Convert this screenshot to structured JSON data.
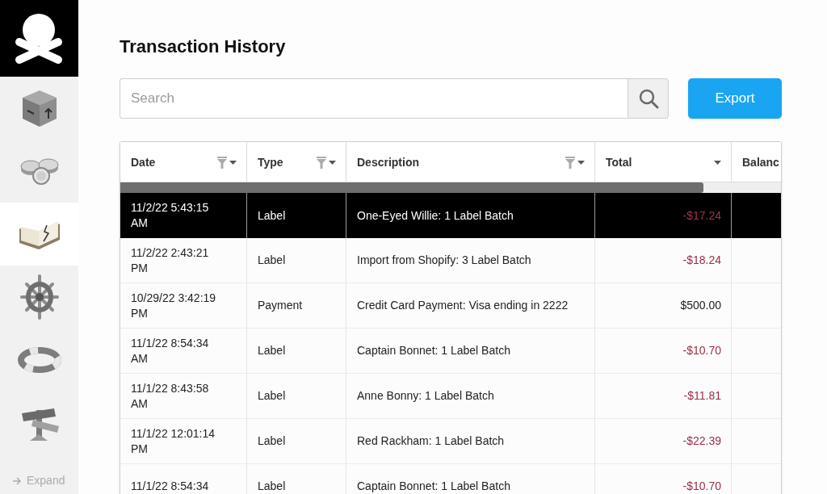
{
  "sidebar": {
    "nav_items": [
      {
        "selected": false
      },
      {
        "selected": false
      },
      {
        "selected": true
      },
      {
        "selected": false
      },
      {
        "selected": false
      },
      {
        "selected": false
      }
    ],
    "expand_label": "Expand"
  },
  "title": "Transaction History",
  "search": {
    "placeholder": "Search"
  },
  "export_button": "Export",
  "table": {
    "columns": [
      {
        "label": "Date",
        "filter": true,
        "menu": true
      },
      {
        "label": "Type",
        "filter": true,
        "menu": true
      },
      {
        "label": "Description",
        "filter": true,
        "menu": true
      },
      {
        "label": "Total",
        "filter": false,
        "menu": true
      },
      {
        "label": "Balanc"
      }
    ],
    "rows": [
      {
        "selected": true,
        "date": "11/2/22 5:43:15 AM",
        "type": "Label",
        "description": "One-Eyed Willie: 1 Label Batch",
        "total": "-$17.24",
        "debit": true
      },
      {
        "selected": false,
        "date": "11/2/22 2:43:21 PM",
        "type": "Label",
        "description": "Import from Shopify: 3 Label Batch",
        "total": "-$18.24",
        "debit": true
      },
      {
        "selected": false,
        "date": "10/29/22 3:42:19 PM",
        "type": "Payment",
        "description": "Credit Card Payment: Visa ending in 2222",
        "total": "$500.00",
        "debit": false
      },
      {
        "selected": false,
        "date": "11/1/22 8:54:34 AM",
        "type": "Label",
        "description": "Captain Bonnet: 1 Label Batch",
        "total": "-$10.70",
        "debit": true
      },
      {
        "selected": false,
        "date": "11/1/22 8:43:58 AM",
        "type": "Label",
        "description": "Anne Bonny: 1 Label Batch",
        "total": "-$11.81",
        "debit": true
      },
      {
        "selected": false,
        "date": "11/1/22 12:01:14 PM",
        "type": "Label",
        "description": "Red Rackham: 1 Label Batch",
        "total": "-$22.39",
        "debit": true
      },
      {
        "selected": false,
        "date": "11/1/22 8:54:34",
        "type": "Label",
        "description": "Captain Bonnet: 1 Label Batch",
        "total": "-$10.70",
        "debit": true
      }
    ]
  }
}
